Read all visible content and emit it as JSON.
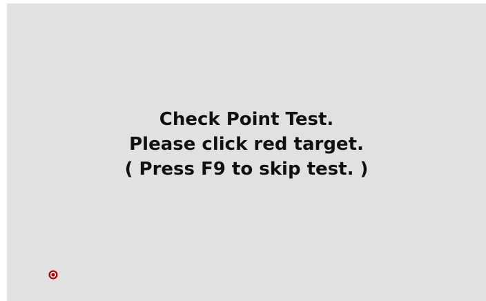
{
  "test": {
    "line1": "Check Point Test.",
    "line2": "Please click red target.",
    "line3": "( Press F9 to skip test. )"
  },
  "target": {
    "icon": "red-target-icon",
    "color": "#b30000",
    "inner_color": "#ffffff"
  },
  "colors": {
    "background": "#e1e1e1",
    "text": "#111111"
  }
}
